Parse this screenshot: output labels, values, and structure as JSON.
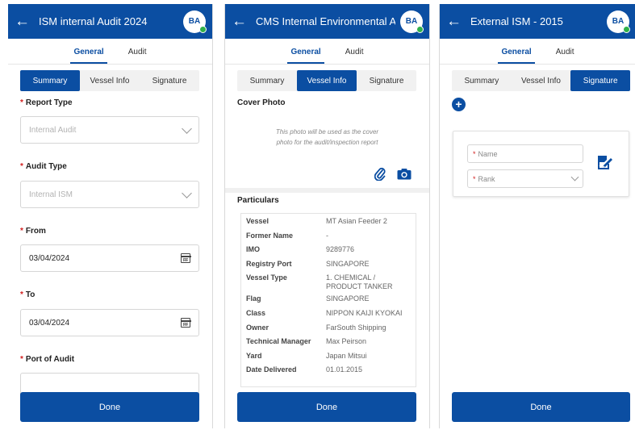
{
  "colors": {
    "primary": "#0b4ea2",
    "required": "#d21f1f",
    "online": "#2fb14a"
  },
  "screens": [
    {
      "header": {
        "back_icon": "arrow-left",
        "title": "ISM internal Audit 2024",
        "avatar": "BA"
      },
      "top_tabs": [
        "General",
        "Audit"
      ],
      "seg_tabs": [
        "Summary",
        "Vessel Info",
        "Signature"
      ],
      "fields": {
        "report_type": {
          "label": "Report Type",
          "placeholder": "Internal Audit"
        },
        "audit_type": {
          "label": "Audit Type",
          "placeholder": "Internal ISM"
        },
        "from": {
          "label": "From",
          "value": "03/04/2024"
        },
        "to": {
          "label": "To",
          "value": "03/04/2024"
        },
        "port": {
          "label": "Port of Audit"
        }
      },
      "done": "Done"
    },
    {
      "header": {
        "back_icon": "arrow-left",
        "title": "CMS Internal Environmental Au",
        "avatar": "BA"
      },
      "top_tabs": [
        "General",
        "Audit"
      ],
      "seg_tabs": [
        "Summary",
        "Vessel Info",
        "Signature"
      ],
      "cover": {
        "title": "Cover Photo",
        "note_line1": "This photo will be used as the cover",
        "note_line2": "photo for the audit/inspection report",
        "icons": [
          "paperclip-icon",
          "camera-icon"
        ]
      },
      "particulars": {
        "title": "Particulars",
        "rows": [
          {
            "key": "Vessel",
            "value": "MT Asian Feeder 2"
          },
          {
            "key": "Former Name",
            "value": "-"
          },
          {
            "key": "IMO",
            "value": "9289776"
          },
          {
            "key": "Registry Port",
            "value": "SINGAPORE"
          },
          {
            "key": "Vessel Type",
            "value": "1. CHEMICAL / PRODUCT TANKER"
          },
          {
            "key": "Flag",
            "value": "SINGAPORE"
          },
          {
            "key": "Class",
            "value": "NIPPON KAIJI KYOKAI"
          },
          {
            "key": "Owner",
            "value": "FarSouth Shipping"
          },
          {
            "key": "Technical Manager",
            "value": "Max Peirson"
          },
          {
            "key": "Yard",
            "value": "Japan Mitsui"
          },
          {
            "key": "Date Delivered",
            "value": "01.01.2015"
          }
        ]
      },
      "done": "Done"
    },
    {
      "header": {
        "back_icon": "arrow-left",
        "title": "External ISM - 2015",
        "avatar": "BA"
      },
      "top_tabs": [
        "General",
        "Audit"
      ],
      "seg_tabs": [
        "Summary",
        "Vessel Info",
        "Signature"
      ],
      "add_icon": "plus-icon",
      "signature": {
        "name_placeholder": "Name",
        "rank_placeholder": "Rank",
        "sign_icon": "signature-edit-icon"
      },
      "done": "Done"
    }
  ]
}
